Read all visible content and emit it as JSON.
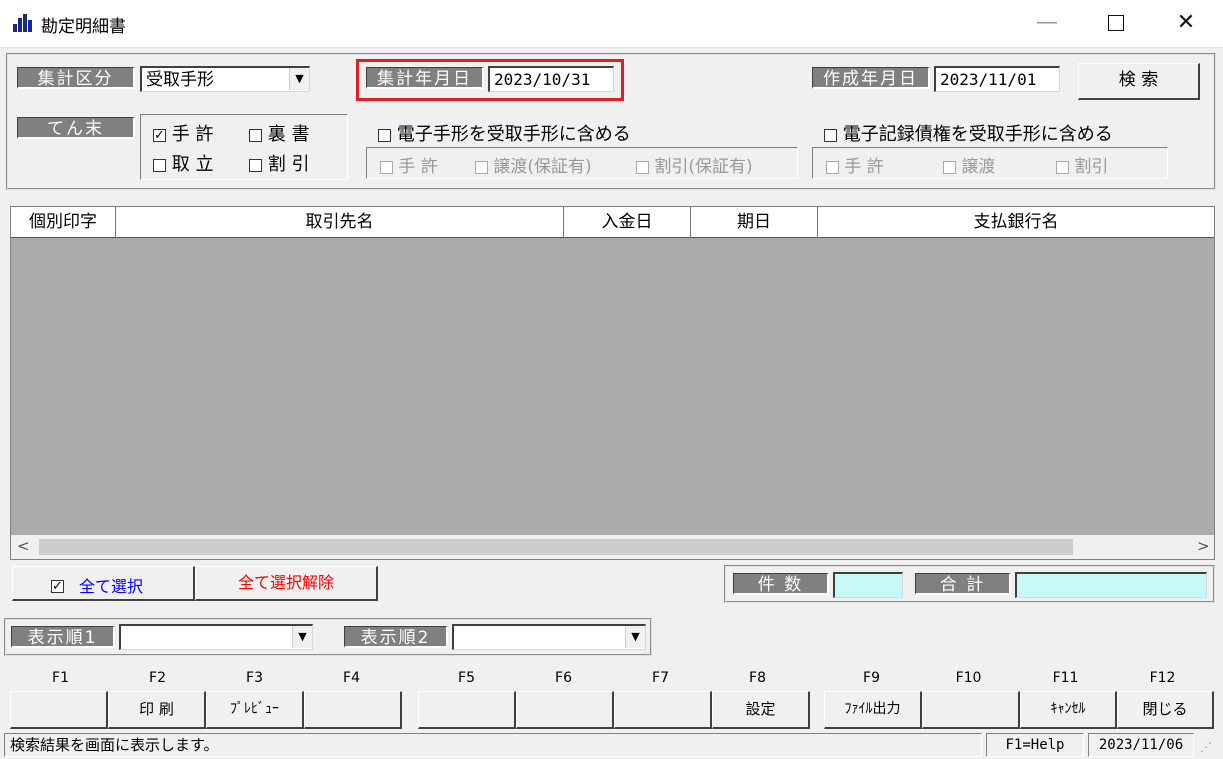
{
  "window": {
    "title": "勘定明細書",
    "controls": {
      "minimize": "—",
      "close": "✕"
    }
  },
  "filters": {
    "aggregation_label": "集計区分",
    "aggregation_value": "受取手形",
    "date_label": "集計年月日",
    "date_value": "2023/10/31",
    "created_label": "作成年月日",
    "created_value": "2023/11/01",
    "search_button": "検 索",
    "tenmatsu_label": "てん末",
    "tenmatsu_options": [
      {
        "label": "手 許",
        "checked": true
      },
      {
        "label": "裏 書",
        "checked": false
      },
      {
        "label": "取 立",
        "checked": false
      },
      {
        "label": "割 引",
        "checked": false
      }
    ],
    "include_electronic": "電子手形を受取手形に含める",
    "electronic_sub": [
      "手 許",
      "譲渡(保証有)",
      "割引(保証有)"
    ],
    "include_erecord": "電子記録債権を受取手形に含める",
    "erecord_sub": [
      "手 許",
      "譲渡",
      "割引"
    ]
  },
  "grid": {
    "columns": [
      "個別印字",
      "取引先名",
      "入金日",
      "期日",
      "支払銀行名"
    ],
    "rows": []
  },
  "scroll": {
    "left": "<",
    "right": ">"
  },
  "selection": {
    "select_all": "全て選択",
    "deselect_all": "全て選択解除",
    "count_label": "件 数",
    "count_value": "",
    "total_label": "合 計",
    "total_value": ""
  },
  "sort": {
    "order1_label": "表示順1",
    "order1_value": "",
    "order2_label": "表示順2",
    "order2_value": ""
  },
  "fkeys": [
    {
      "key": "F1",
      "label": ""
    },
    {
      "key": "F2",
      "label": "印 刷"
    },
    {
      "key": "F3",
      "label": "ﾌﾟﾚﾋﾞｭｰ"
    },
    {
      "key": "F4",
      "label": ""
    },
    {
      "key": "F5",
      "label": ""
    },
    {
      "key": "F6",
      "label": ""
    },
    {
      "key": "F7",
      "label": ""
    },
    {
      "key": "F8",
      "label": "設定"
    },
    {
      "key": "F9",
      "label": "ﾌｧｲﾙ出力"
    },
    {
      "key": "F10",
      "label": ""
    },
    {
      "key": "F11",
      "label": "ｷｬﾝｾﾙ"
    },
    {
      "key": "F12",
      "label": "閉じる"
    }
  ],
  "status": {
    "message": "検索結果を画面に表示します。",
    "help": "F1=Help",
    "date": "2023/11/06"
  },
  "colors": {
    "highlight_box": "#e02020",
    "select_all_text": "#0000ff",
    "deselect_all_text": "#ff0000",
    "summary_fill": "#c8f8f8",
    "grid_bg": "#ababab"
  }
}
